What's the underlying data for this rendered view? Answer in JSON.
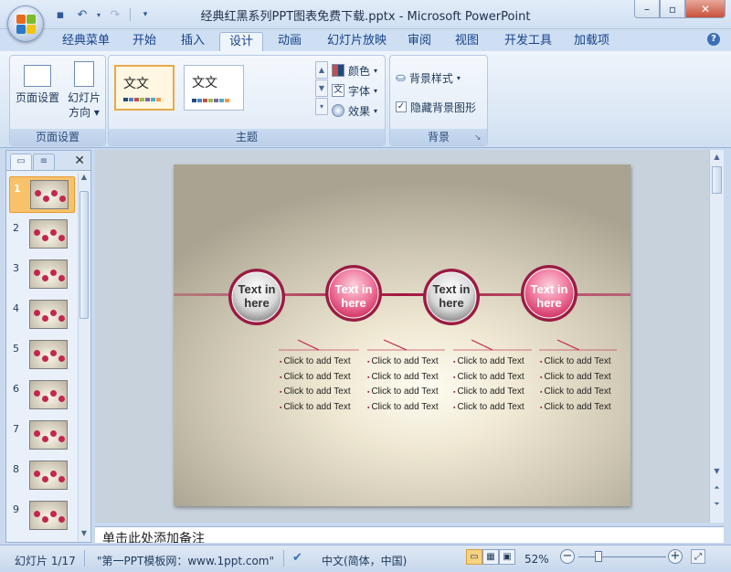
{
  "window": {
    "title": "经典红黑系列PPT图表免费下载.pptx - Microsoft PowerPoint"
  },
  "tabs": [
    "经典菜单",
    "开始",
    "插入",
    "设计",
    "动画",
    "幻灯片放映",
    "审阅",
    "视图",
    "开发工具",
    "加载项"
  ],
  "active_tab": "设计",
  "ribbon": {
    "page_setup": {
      "page_setup_label": "页面设置",
      "orientation_label": "幻灯片",
      "orientation_label2": "方向",
      "group_label": "页面设置"
    },
    "themes": {
      "theme1_text": "文文",
      "theme2_text": "文文",
      "colors_label": "颜色",
      "fonts_label": "字体",
      "effects_label": "效果",
      "group_label": "主题"
    },
    "background": {
      "bg_styles_label": "背景样式",
      "hide_bg_label": "隐藏背景图形",
      "hide_bg_checked": true,
      "group_label": "背景"
    }
  },
  "slides_pane": {
    "slide_numbers": [
      "1",
      "2",
      "3",
      "4",
      "5",
      "6",
      "7",
      "8",
      "9"
    ],
    "selected": "1"
  },
  "slide": {
    "circles": [
      {
        "line1": "Text in",
        "line2": "here",
        "style": "gray"
      },
      {
        "line1": "Text in",
        "line2": "here",
        "style": "pink"
      },
      {
        "line1": "Text in",
        "line2": "here",
        "style": "gray"
      },
      {
        "line1": "Text in",
        "line2": "here",
        "style": "pink"
      }
    ],
    "bullet_text": "Click to add Text"
  },
  "notes": {
    "placeholder": "单击此处添加备注"
  },
  "statusbar": {
    "slide_count": "幻灯片 1/17",
    "theme_name": "\"第一PPT模板网：www.1ppt.com\"",
    "language": "中文(简体，中国)",
    "zoom": "52%"
  }
}
